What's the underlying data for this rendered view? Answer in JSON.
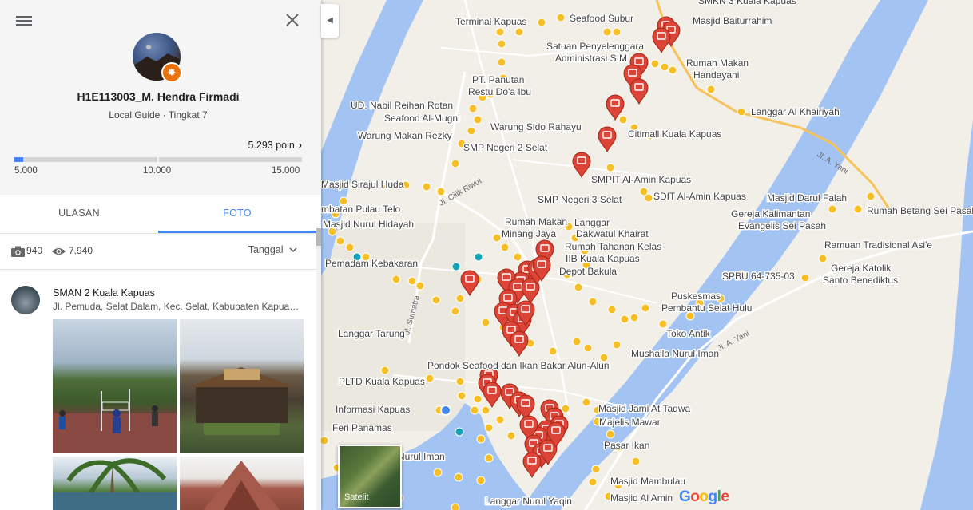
{
  "profile": {
    "name": "H1E113003_M. Hendra Firmadi",
    "level": "Local Guide · Tingkat 7",
    "points": "5.293 poin",
    "points_value": 5293,
    "progress_min": 5000,
    "progress_max": 15000,
    "ticks": [
      "5.000",
      "10.000",
      "15.000"
    ]
  },
  "tabs": [
    {
      "label": "ULASAN",
      "active": false
    },
    {
      "label": "FOTO",
      "active": true
    }
  ],
  "stats": {
    "photos": "940",
    "views": "7.940",
    "sort": "Tanggal"
  },
  "place": {
    "name": "SMAN 2 Kuala Kapuas",
    "address": "Jl. Pemuda, Selat Dalam, Kec. Selat, Kabupaten Kapuas, Kalimantan Tengah"
  },
  "map": {
    "satellite_label": "Satelit",
    "logo": "Google",
    "labels": [
      "Terminal Kapuas",
      "Seafood Subur",
      "SMKN 3 Kuala Kapuas",
      "Masjid Baiturrahim",
      "Satuan Penyelenggara",
      "Administrasi SIM",
      "Rumah Makan",
      "Handayani",
      "PT. Panutan",
      "Restu Do'a Ibu",
      "UD. Nabil Reihan Rotan",
      "Seafood Al-Mugni",
      "Warung Sido Rahayu",
      "Warung Makan Rezky",
      "SMP Negeri 2 Selat",
      "Langgar Al Khairiyah",
      "Citimall Kuala Kapuas",
      "SMPIT Al-Amin Kapuas",
      "SMP Negeri 3 Selat",
      "SDIT Al-Amin Kapuas",
      "Masjid Sirajul Huda",
      "Masjid Darul Falah",
      "Rumah Betang Sei Pasah",
      "Gereja Kalimantan",
      "Evangelis Sei Pasah",
      "mbatan Pulau Telo",
      "Masjid Nurul Hidayah",
      "Rumah Makan",
      "Minang Jaya",
      "Langgar",
      "Dakwatul Khairat",
      "Rumah Tahanan Kelas",
      "IIB Kuala Kapuas",
      "Depot Bakula",
      "Ramuan Tradisional Asi'e",
      "Gereja Katolik",
      "Santo Benediktus",
      "SPBU 64-735-03",
      "Pemadam Kebakaran",
      "Puskesmas",
      "Pembantu Selat Hulu",
      "Langgar Tarung",
      "Toko Antik",
      "Mushalla Nurul Iman",
      "Pondok Seafood dan Ikan Bakar Alun-Alun",
      "PLTD Kuala Kapuas",
      "Informasi Kapuas",
      "Masjid Jami At Taqwa",
      "Majelis Mawar",
      "Feri Panamas",
      "Pasar Ikan",
      "Nurul Iman",
      "Masjid Mambulau",
      "Masjid Al Amin",
      "Langgar Nurul Yaqin"
    ],
    "road_labels": [
      "Jl. A. Yani",
      "Jl. A. Yani",
      "Jl. Cilik Riwut",
      "Jl. Sumatra"
    ]
  },
  "colors": {
    "accent": "#4285f4",
    "river": "#a3c4f3",
    "land": "#f2efe9",
    "pin_red": "#db4437",
    "poi_yellow": "#f6bf26",
    "poi_teal": "#12a3b8",
    "badge": "#e8710a"
  }
}
